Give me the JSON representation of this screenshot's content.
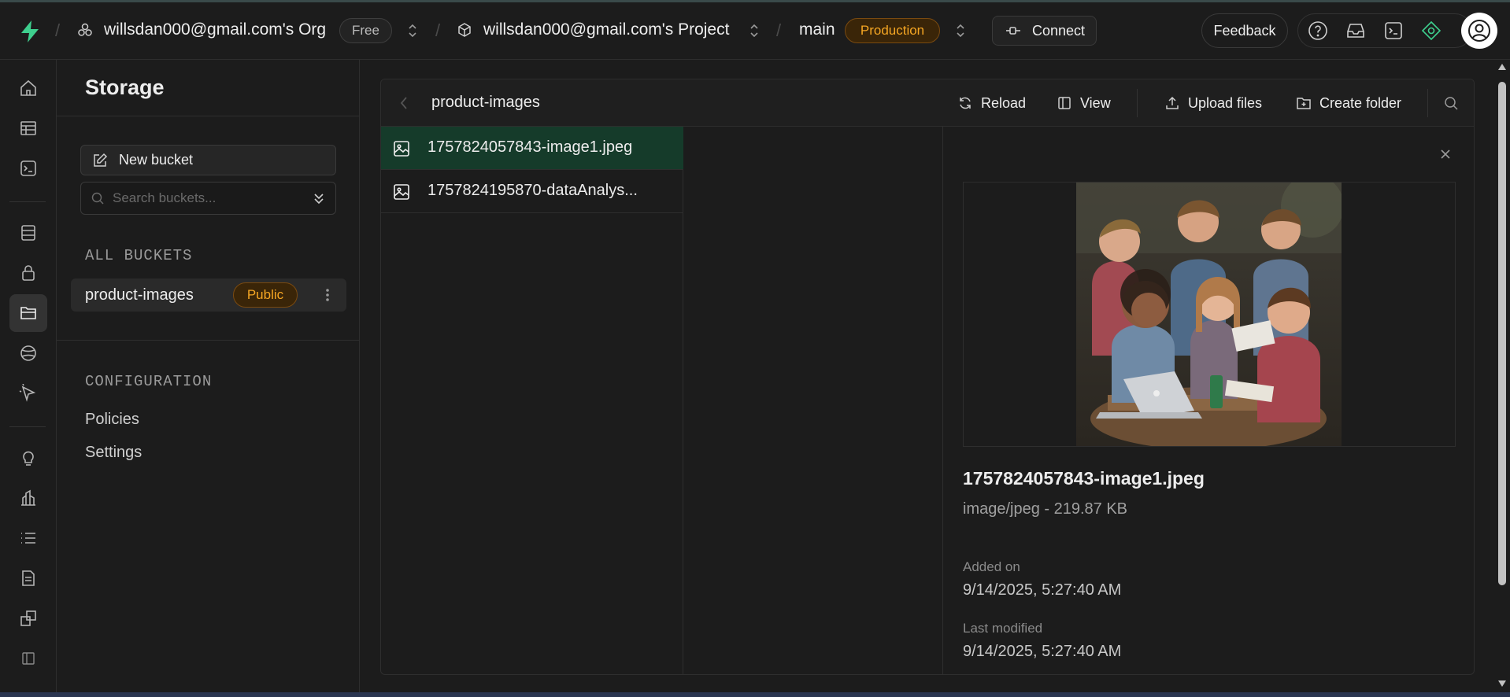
{
  "topbar": {
    "org_name": "willsdan000@gmail.com's Org",
    "plan_badge": "Free",
    "project_name": "willsdan000@gmail.com's Project",
    "branch": "main",
    "env_badge": "Production",
    "connect_label": "Connect",
    "feedback_label": "Feedback",
    "icons": [
      "help-icon",
      "inbox-icon",
      "terminal-icon",
      "advisor-icon"
    ]
  },
  "rail": {
    "items": [
      "home-icon",
      "table-editor-icon",
      "sql-editor-icon",
      "database-icon",
      "auth-icon",
      "storage-icon",
      "realtime-icon",
      "edge-functions-icon",
      "advisors-icon",
      "reports-icon",
      "logs-icon",
      "api-docs-icon",
      "integrations-icon",
      "settings-icon"
    ],
    "active": "storage-icon"
  },
  "sidebar": {
    "title": "Storage",
    "new_bucket_label": "New bucket",
    "search_placeholder": "Search buckets...",
    "all_buckets_label": "ALL BUCKETS",
    "buckets": [
      {
        "name": "product-images",
        "badge": "Public"
      }
    ],
    "configuration_label": "CONFIGURATION",
    "config_links": [
      "Policies",
      "Settings"
    ]
  },
  "explorer": {
    "bucket_title": "product-images",
    "toolbar": {
      "reload": "Reload",
      "view": "View",
      "upload": "Upload files",
      "create_folder": "Create folder"
    },
    "files": [
      {
        "name": "1757824057843-image1.jpeg",
        "selected": true
      },
      {
        "name": "1757824195870-dataAnalys...",
        "selected": false
      }
    ],
    "preview": {
      "file_name": "1757824057843-image1.jpeg",
      "meta": "image/jpeg - 219.87 KB",
      "added_label": "Added on",
      "added_value": "9/14/2025, 5:27:40 AM",
      "modified_label": "Last modified",
      "modified_value": "9/14/2025, 5:27:40 AM"
    }
  },
  "colors": {
    "accent_green": "#3ecf8e",
    "selected_row": "#153b2a",
    "warning_orange": "#f5a623"
  }
}
